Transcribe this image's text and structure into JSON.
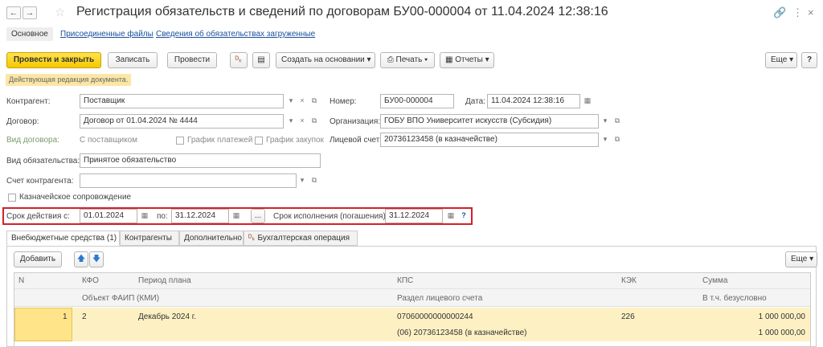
{
  "window": {
    "title": "Регистрация обязательств и сведений по договорам БУ00-000004 от 11.04.2024 12:38:16",
    "back_icon": "←",
    "forward_icon": "→",
    "star_icon": "☆",
    "link_icon": "🔗",
    "more_icon": "⋮",
    "close_icon": "×"
  },
  "tabs": [
    {
      "label": "Основное"
    },
    {
      "label": "Присоединенные файлы"
    },
    {
      "label": "Сведения об обязательствах загруженные"
    }
  ],
  "toolbar": {
    "post_close": "Провести и закрыть",
    "save": "Записать",
    "post": "Провести",
    "create_based": "Создать на основании ▾",
    "print": "Печать ▾",
    "reports": "Отчеты ▾",
    "more": "Еще ▾",
    "help": "?"
  },
  "notice": "Действующая редакция документа.",
  "form": {
    "counterparty_label": "Контрагент:",
    "counterparty_value": "Поставщик",
    "contract_label": "Договор:",
    "contract_value": "Договор от 01.04.2024 № 4444",
    "contract_type_label": "Вид договора:",
    "contract_type_value": "С поставщиком",
    "payment_schedule_label": "График платежей",
    "purchase_schedule_label": "График закупок",
    "obligation_type_label": "Вид обязательства:",
    "obligation_type_value": "Принятое обязательство",
    "account_label": "Счет контрагента:",
    "account_value": "",
    "treasury_label": "Казначейское сопровождение",
    "number_label": "Номер:",
    "number_value": "БУ00-000004",
    "date_label": "Дата:",
    "date_value": "11.04.2024 12:38:16",
    "org_label": "Организация:",
    "org_value": "ГОБУ ВПО Университет искусств (Субсидия)",
    "personal_account_label": "Лицевой счет:",
    "personal_account_value": "20736123458 (в казначействе)",
    "validity_from_label": "Срок действия с:",
    "validity_from_value": "01.01.2024",
    "validity_to_label": "по:",
    "validity_to_value": "31.12.2024",
    "ellipsis": "...",
    "execution_label": "Срок исполнения (погашения):",
    "execution_value": "31.12.2024",
    "help_mark": "?"
  },
  "lower_tabs": [
    {
      "label": "Внебюджетные средства (1)"
    },
    {
      "label": "Контрагенты"
    },
    {
      "label": "Дополнительно"
    },
    {
      "label": "Бухгалтерская операция"
    }
  ],
  "table_toolbar": {
    "add": "Добавить",
    "more": "Еще ▾"
  },
  "table": {
    "headers_row1": {
      "n": "N",
      "kfo": "КФО",
      "period": "Период плана",
      "kps": "КПС",
      "kek": "КЭК",
      "sum": "Сумма"
    },
    "headers_row2": {
      "faip": "Объект ФАИП (КМИ)",
      "section": "Раздел лицевого счета",
      "incl": "В т.ч. безусловно"
    },
    "rows": [
      {
        "n": "1",
        "kfo": "2",
        "period": "Декабрь 2024 г.",
        "kps": "07060000000000244",
        "kek": "226",
        "sum": "1 000 000,00",
        "section": "(06) 20736123458 (в казначействе)",
        "incl": "1 000 000,00"
      }
    ]
  },
  "colors": {
    "accent_yellow": "#f5c800",
    "highlight_red": "#d4202a",
    "link_blue": "#1a4f9c",
    "selected_row": "#fdf1c4"
  }
}
